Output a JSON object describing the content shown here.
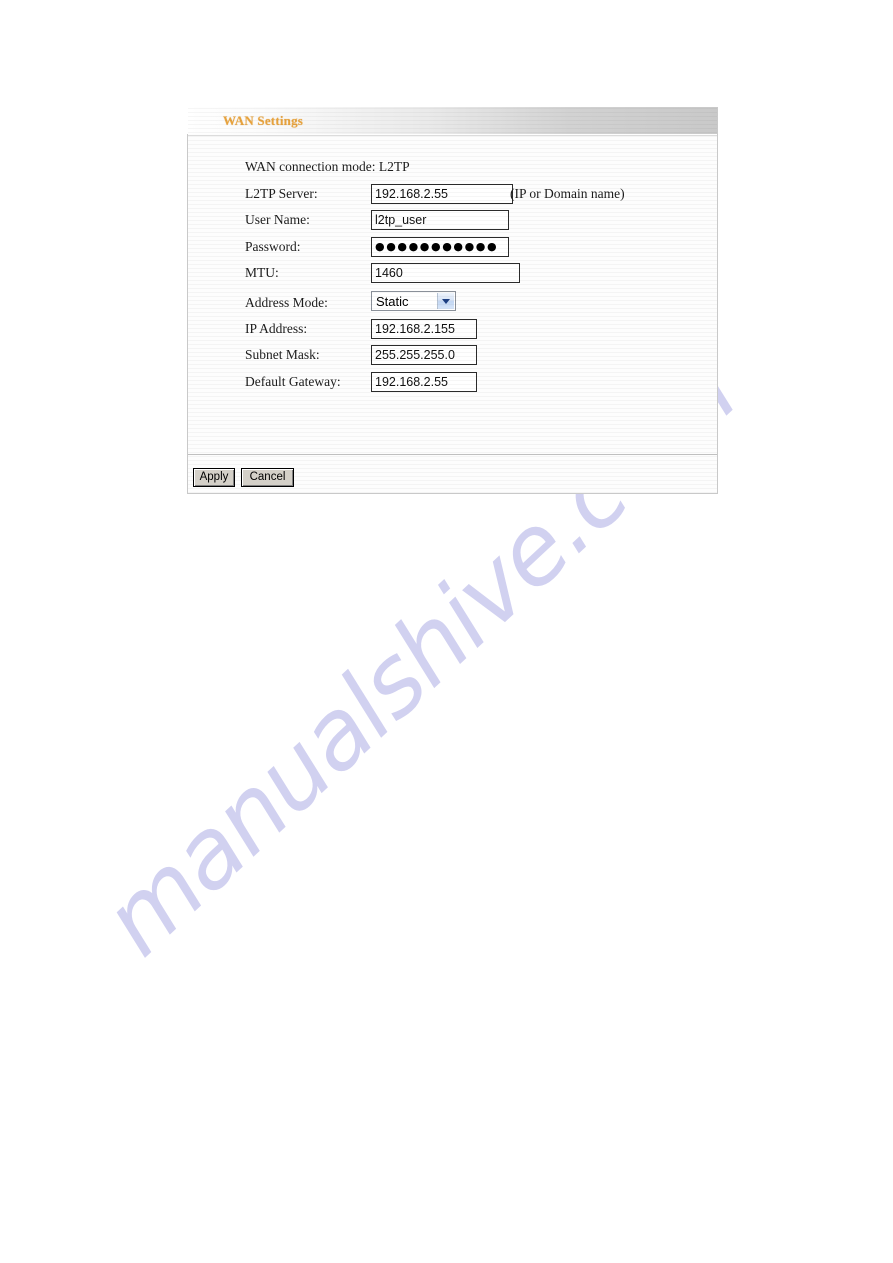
{
  "panel": {
    "title": "WAN Settings",
    "connection_mode_line": "WAN connection mode: L2TP",
    "fields": [
      {
        "name": "l2tp-server",
        "label": "L2TP Server:",
        "value": "192.168.2.55",
        "hint": "(IP or Domain name)",
        "type": "text"
      },
      {
        "name": "user-name",
        "label": "User Name:",
        "value": "l2tp_user",
        "type": "text"
      },
      {
        "name": "password",
        "label": "Password:",
        "value": "●●●●●●●●●●●",
        "type": "password"
      },
      {
        "name": "mtu",
        "label": "MTU:",
        "value": "1460",
        "type": "text"
      },
      {
        "name": "address-mode",
        "label": "Address Mode:",
        "value": "Static",
        "type": "select"
      },
      {
        "name": "ip-address",
        "label": "IP Address:",
        "value": "192.168.2.155",
        "type": "text"
      },
      {
        "name": "subnet-mask",
        "label": "Subnet Mask:",
        "value": "255.255.255.0",
        "type": "text"
      },
      {
        "name": "default-gateway",
        "label": "Default Gateway:",
        "value": "192.168.2.55",
        "type": "text"
      }
    ],
    "buttons": {
      "apply": "Apply",
      "cancel": "Cancel"
    },
    "colors": {
      "title": "#e8a33d",
      "header_gradient_start": "#ffffff",
      "header_gradient_end": "#c9c9c9",
      "select_arrow": "#1d3f82",
      "button_face": "#d4d0c8"
    }
  },
  "watermark": {
    "text": "manualshive.com",
    "color": "#cfcff0"
  }
}
